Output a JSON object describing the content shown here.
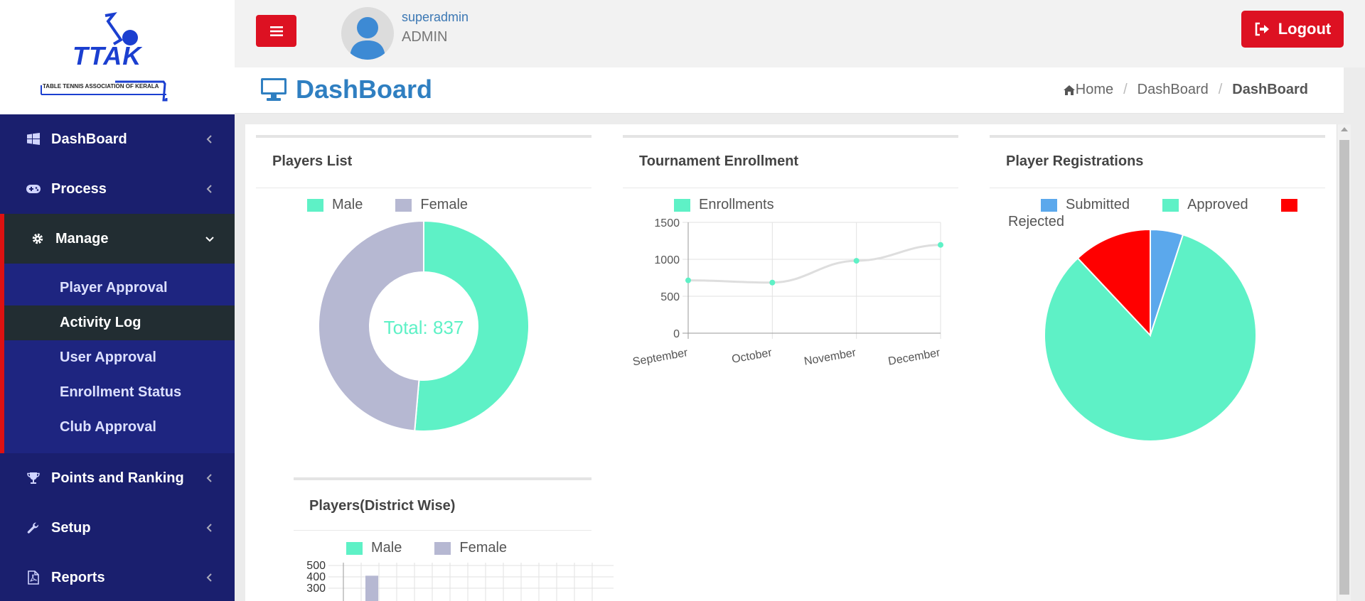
{
  "logo": {
    "mark_text": "TTAK",
    "tagline": "TABLE TENNIS ASSOCIATION OF KERALA"
  },
  "header": {
    "username": "superadmin",
    "role": "ADMIN",
    "logout_label": "Logout",
    "menu_icon": "hamburger-icon",
    "logout_icon": "sign-out-icon"
  },
  "sidebar": {
    "items": [
      {
        "label": "DashBoard",
        "icon": "windows-icon"
      },
      {
        "label": "Process",
        "icon": "gamepad-icon"
      },
      {
        "label": "Manage",
        "icon": "gear-icon",
        "expanded": true,
        "children": [
          {
            "label": "Player Approval"
          },
          {
            "label": "Activity Log",
            "current": true
          },
          {
            "label": "User Approval"
          },
          {
            "label": "Enrollment Status"
          },
          {
            "label": "Club Approval"
          }
        ]
      },
      {
        "label": "Points and Ranking",
        "icon": "trophy-icon"
      },
      {
        "label": "Setup",
        "icon": "wrench-icon"
      },
      {
        "label": "Reports",
        "icon": "file-pdf-icon"
      }
    ]
  },
  "page": {
    "title": "DashBoard",
    "title_icon": "monitor-icon",
    "breadcrumb": {
      "home": "Home",
      "parent": "DashBoard",
      "current": "DashBoard",
      "separator": "/"
    }
  },
  "colors": {
    "male": "#5ef1c6",
    "female": "#b6b8d2",
    "submitted": "#5ba8ec",
    "approved": "#5ef1c6",
    "rejected": "#ff0000",
    "accent_red": "#dd1122",
    "title_blue": "#2f7fc1"
  },
  "panels": {
    "players_list": {
      "title": "Players List",
      "legend": [
        "Male",
        "Female"
      ],
      "center_label": "Total: 837"
    },
    "tournament_enrollment": {
      "title": "Tournament Enrollment",
      "legend": [
        "Enrollments"
      ]
    },
    "player_registrations": {
      "title": "Player Registrations",
      "legend": [
        "Submitted",
        "Approved",
        "Rejected"
      ]
    },
    "players_district": {
      "title": "Players(District Wise)",
      "legend": [
        "Male",
        "Female"
      ]
    }
  },
  "chart_data": [
    {
      "type": "pie",
      "title": "Players List",
      "categories": [
        "Male",
        "Female"
      ],
      "values": [
        430,
        407
      ],
      "donut": true,
      "center_label": "Total: 837"
    },
    {
      "type": "line",
      "title": "Tournament Enrollment",
      "categories": [
        "September",
        "October",
        "November",
        "December"
      ],
      "series": [
        {
          "name": "Enrollments",
          "values": [
            715,
            685,
            980,
            1195
          ]
        }
      ],
      "ylim": [
        0,
        1500
      ],
      "yticks": [
        0,
        500,
        1000,
        1500
      ],
      "grid": true,
      "legend": "top"
    },
    {
      "type": "pie",
      "title": "Player Registrations",
      "categories": [
        "Submitted",
        "Approved",
        "Rejected"
      ],
      "values": [
        5,
        83,
        12
      ],
      "legend": "top"
    },
    {
      "type": "bar",
      "title": "Players(District Wise)",
      "series": [
        {
          "name": "Male",
          "values": []
        },
        {
          "name": "Female",
          "values": [
            410
          ]
        }
      ],
      "yticks_visible": [
        300,
        400,
        500
      ],
      "grid": true,
      "legend": "top"
    }
  ]
}
